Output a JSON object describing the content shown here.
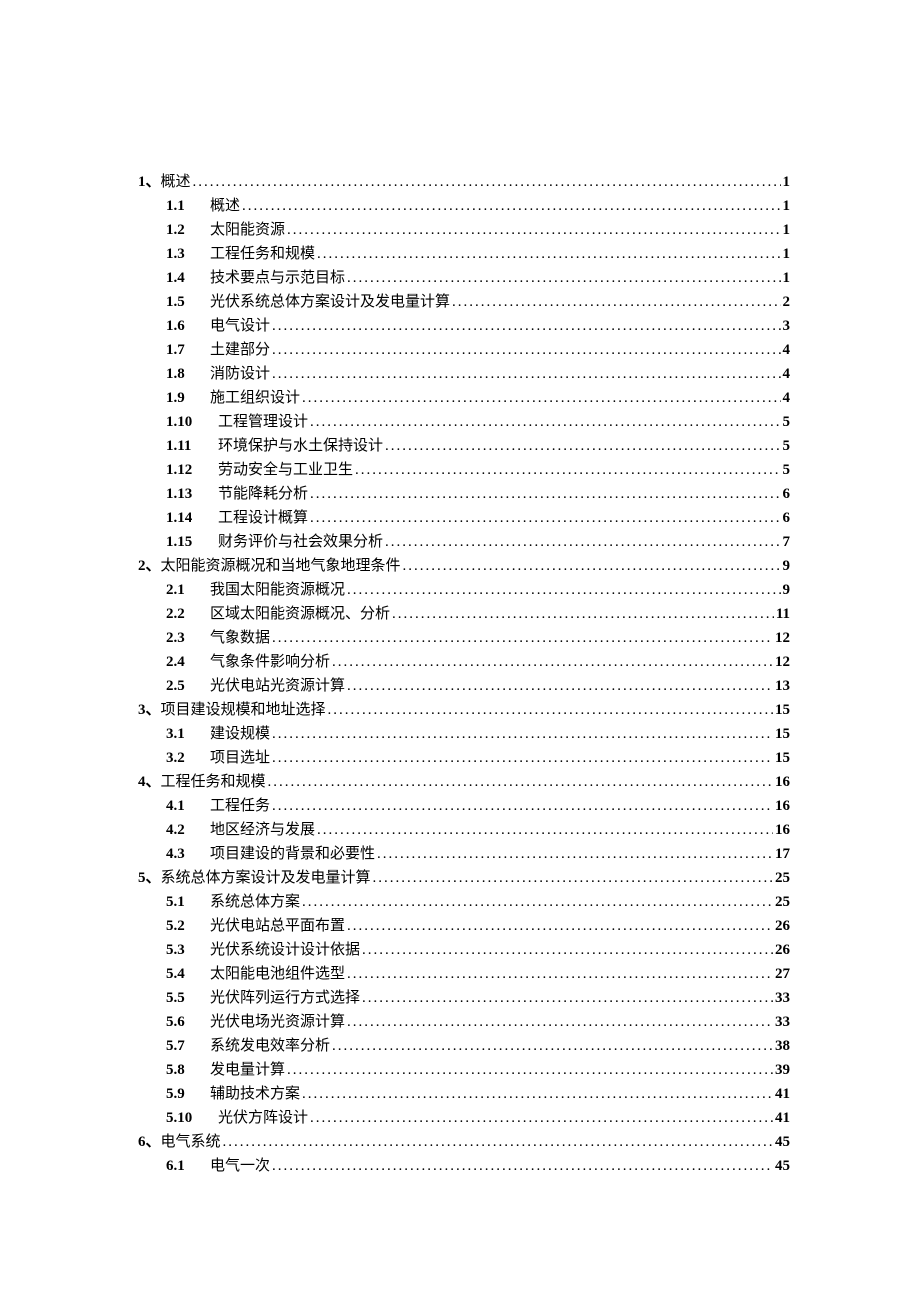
{
  "entries": [
    {
      "level": 1,
      "num": "1、",
      "title": "概述",
      "page": "1"
    },
    {
      "level": 2,
      "num": "1.1",
      "title": "概述",
      "page": "1"
    },
    {
      "level": 2,
      "num": "1.2",
      "title": "太阳能资源",
      "page": "1"
    },
    {
      "level": 2,
      "num": "1.3",
      "title": "工程任务和规模",
      "page": "1"
    },
    {
      "level": 2,
      "num": "1.4",
      "title": "技术要点与示范目标",
      "page": "1"
    },
    {
      "level": 2,
      "num": "1.5",
      "title": "光伏系统总体方案设计及发电量计算",
      "page": "2"
    },
    {
      "level": 2,
      "num": "1.6",
      "title": "电气设计",
      "page": "3"
    },
    {
      "level": 2,
      "num": "1.7",
      "title": "土建部分",
      "page": "4"
    },
    {
      "level": 2,
      "num": "1.8",
      "title": "消防设计",
      "page": "4"
    },
    {
      "level": 2,
      "num": "1.9",
      "title": "施工组织设计",
      "page": "4"
    },
    {
      "level": 2,
      "num": "1.10",
      "title": "工程管理设计",
      "page": "5",
      "wide": true
    },
    {
      "level": 2,
      "num": "1.11",
      "title": "环境保护与水土保持设计",
      "page": "5",
      "wide": true
    },
    {
      "level": 2,
      "num": "1.12",
      "title": "劳动安全与工业卫生",
      "page": "5",
      "wide": true
    },
    {
      "level": 2,
      "num": "1.13",
      "title": "节能降耗分析",
      "page": "6",
      "wide": true
    },
    {
      "level": 2,
      "num": "1.14",
      "title": "工程设计概算",
      "page": "6",
      "wide": true
    },
    {
      "level": 2,
      "num": "1.15",
      "title": "财务评价与社会效果分析",
      "page": "7",
      "wide": true
    },
    {
      "level": 1,
      "num": "2、",
      "title": "太阳能资源概况和当地气象地理条件",
      "page": "9"
    },
    {
      "level": 2,
      "num": "2.1",
      "title": "我国太阳能资源概况",
      "page": "9"
    },
    {
      "level": 2,
      "num": "2.2",
      "title": "区域太阳能资源概况、分析",
      "page": "11"
    },
    {
      "level": 2,
      "num": "2.3",
      "title": "气象数据",
      "page": "12"
    },
    {
      "level": 2,
      "num": "2.4",
      "title": "气象条件影响分析",
      "page": "12"
    },
    {
      "level": 2,
      "num": "2.5",
      "title": "光伏电站光资源计算",
      "page": "13"
    },
    {
      "level": 1,
      "num": "3、",
      "title": "项目建设规模和地址选择",
      "page": "15"
    },
    {
      "level": 2,
      "num": "3.1",
      "title": "建设规模",
      "page": "15"
    },
    {
      "level": 2,
      "num": "3.2",
      "title": "项目选址",
      "page": "15"
    },
    {
      "level": 1,
      "num": "4、",
      "title": "工程任务和规模",
      "page": "16"
    },
    {
      "level": 2,
      "num": "4.1",
      "title": "工程任务",
      "page": "16"
    },
    {
      "level": 2,
      "num": "4.2",
      "title": "地区经济与发展",
      "page": "16"
    },
    {
      "level": 2,
      "num": "4.3",
      "title": "项目建设的背景和必要性",
      "page": "17"
    },
    {
      "level": 1,
      "num": "5、",
      "title": "系统总体方案设计及发电量计算",
      "page": "25"
    },
    {
      "level": 2,
      "num": "5.1",
      "title": "系统总体方案",
      "page": "25"
    },
    {
      "level": 2,
      "num": "5.2",
      "title": "光伏电站总平面布置",
      "page": "26"
    },
    {
      "level": 2,
      "num": "5.3",
      "title": "光伏系统设计设计依据",
      "page": "26"
    },
    {
      "level": 2,
      "num": "5.4",
      "title": "太阳能电池组件选型",
      "page": "27"
    },
    {
      "level": 2,
      "num": "5.5",
      "title": "光伏阵列运行方式选择",
      "page": "33"
    },
    {
      "level": 2,
      "num": "5.6",
      "title": "光伏电场光资源计算",
      "page": "33"
    },
    {
      "level": 2,
      "num": "5.7",
      "title": "系统发电效率分析",
      "page": "38"
    },
    {
      "level": 2,
      "num": "5.8",
      "title": "发电量计算",
      "page": "39"
    },
    {
      "level": 2,
      "num": "5.9",
      "title": "辅助技术方案",
      "page": "41"
    },
    {
      "level": 2,
      "num": "5.10",
      "title": "光伏方阵设计",
      "page": "41",
      "wide": true
    },
    {
      "level": 1,
      "num": "6、",
      "title": "电气系统",
      "page": "45"
    },
    {
      "level": 2,
      "num": "6.1",
      "title": "电气一次",
      "page": "45"
    }
  ],
  "dots": "..................................................................................................................................................................................."
}
